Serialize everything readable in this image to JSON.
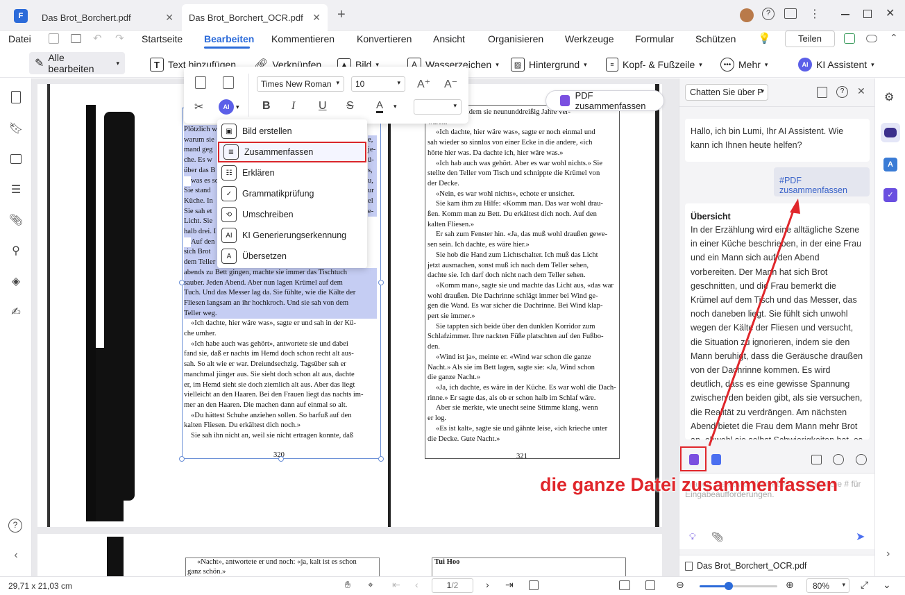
{
  "tabs": [
    {
      "label": "Das Brot_Borchert.pdf"
    },
    {
      "label": "Das Brot_Borchert_OCR.pdf"
    }
  ],
  "menu": {
    "file": "Datei",
    "items": [
      "Startseite",
      "Bearbeiten",
      "Kommentieren",
      "Konvertieren",
      "Ansicht",
      "Organisieren",
      "Werkzeuge",
      "Formular",
      "Schützen"
    ],
    "share": "Teilen"
  },
  "toolbar": {
    "edit_all": "Alle bearbeiten",
    "add_text": "Text hinzufügen",
    "link": "Verknüpfen",
    "image": "Bild",
    "watermark": "Wasserzeichen",
    "background": "Hintergrund",
    "header_footer": "Kopf- & Fußzeile",
    "more": "Mehr",
    "ai": "KI Assistent"
  },
  "format_popup": {
    "font": "Times New Roman",
    "size": "10"
  },
  "ai_menu": [
    "Bild erstellen",
    "Zusammenfassen",
    "Erklären",
    "Grammatikprüfung",
    "Umschreiben",
    "KI Generierungserkennung",
    "Übersetzen"
  ],
  "summarize_pdf_btn": "PDF zusammenfassen",
  "left_page": {
    "hl_lines": [
      "Plötzlich w",
      "warum sie",
      "mand geg",
      "che. Es w",
      "über das B",
      "was es so",
      "Sie stand",
      "Küche. In",
      "Sie sah et",
      "Licht. Sie",
      "halb drei. I",
      "Auf den",
      "sich Brot",
      "dem Teller",
      "abends zu Bett gingen, machte sie immer das Tischtuch",
      "sauber. Jeden Abend. Aber nun lagen Krümel auf dem",
      "Tuch. Und das Messer lag da. Sie fühlte, wie die Kälte der",
      "Fliesen langsam an ihr hochkroch. Und sie sah von dem",
      "Teller weg."
    ],
    "hl_right": [
      "e,",
      "je-",
      "ü-",
      "s,",
      "u,",
      "ur",
      "el",
      "e-",
      ""
    ],
    "lines": [
      "«Ich dachte, hier wäre was», sagte er und sah in der Kü-",
      "che umher.",
      "«Ich habe auch was gehört», antwortete sie und dabei",
      "fand sie, daß er nachts im Hemd doch schon recht alt aus-",
      "sah. So alt wie er war. Dreiundsechzig. Tagsüber sah er",
      "manchmal jünger aus. Sie sieht doch schon alt aus, dachte",
      "er, im Hemd sieht sie doch ziemlich alt aus. Aber das liegt",
      "vielleicht an den Haaren. Bei den Frauen liegt das nachts im-",
      "mer an den Haaren. Die machen dann auf einmal so alt.",
      "«Du hättest Schuhe anziehen sollen. So barfuß auf den",
      "kalten Fliesen. Du erkältest dich noch.»",
      "Sie sah ihn nicht an, weil sie nicht ertragen konnte, daß"
    ],
    "page_no": "320"
  },
  "right_page": {
    "lines": [
      "er log, nachdem sie neununddreißig Jahre ver-",
      "waren.",
      "«Ich dachte, hier wäre was», sagte er noch einmal und",
      "sah wieder so sinnlos von einer Ecke in die andere, «ich",
      "hörte hier was. Da dachte ich, hier wäre was.»",
      "«Ich hab auch was gehört. Aber es war wohl nichts.» Sie",
      "stellte den Teller vom Tisch und schnippte die Krümel von",
      "der Decke.",
      "«Nein, es war wohl nichts», echote er unsicher.",
      "Sie kam ihm zu Hilfe: «Komm man. Das war wohl drau-",
      "ßen. Komm man zu Bett. Du erkältest dich noch. Auf den",
      "kalten Fliesen.»",
      "Er sah zum Fenster hin. «Ja, das muß wohl draußen gewe-",
      "sen sein. Ich dachte, es wäre hier.»",
      "Sie hob die Hand zum Lichtschalter. Ich muß das Licht",
      "jetzt ausmachen, sonst muß ich nach dem Teller sehen,",
      "dachte sie. Ich darf doch nicht nach dem Teller sehen.",
      "«Komm man», sagte sie und machte das Licht aus, «das war",
      "wohl draußen. Die Dachrinne schlägt immer bei Wind ge-",
      "gen die Wand. Es war sicher die Dachrinne. Bei Wind klap-",
      "pert sie immer.»",
      "Sie tappten sich beide über den dunklen Korridor zum",
      "Schlafzimmer. Ihre nackten Füße platschten auf den Fußbo-",
      "den.",
      "«Wind ist ja», meinte er. «Wind war schon die ganze",
      "Nacht.» Als sie im Bett lagen, sagte sie: «Ja, Wind schon",
      "die ganze Nacht.»",
      "«Ja, ich dachte, es wäre in der Küche. Es war wohl die Dach-",
      "rinne.» Er sagte das, als ob er schon halb im Schlaf wäre.",
      "Aber sie merkte, wie unecht seine Stimme klang, wenn",
      "er log.",
      "«Es ist kalt», sagte sie und gähnte leise, «ich krieche unter",
      "die Decke. Gute Nacht.»"
    ],
    "page_no": "321"
  },
  "page2": {
    "left": "«Nacht», antwortete er und noch: «ja, kalt ist es schon",
    "left2": "ganz schön.»",
    "right": "Tui Hoo"
  },
  "chat": {
    "mode": "Chatten Sie über P",
    "greeting": "Hallo, ich bin Lumi, Ihr AI Assistent. Wie kann ich Ihnen heute helfen?",
    "user_msg": "#PDF zusammenfassen",
    "summary_title": "Übersicht",
    "summary": "In der Erzählung wird eine alltägliche Szene in einer Küche beschrieben, in der eine Frau und ein Mann sich auf den Abend vorbereiten. Der Mann hat sich Brot geschnitten, und die Frau bemerkt die Krümel auf dem Tisch und das Messer, das noch daneben liegt. Sie fühlt sich unwohl wegen der Kälte der Fliesen und versucht, die Situation zu ignorieren, indem sie den Mann beruhigt, dass die Geräusche draußen von der Dachrinne kommen. Es wird deutlich, dass es eine gewisse Spannung zwischen den beiden gibt, als sie versuchen, die Realität zu verdrängen. Am nächsten Abend bietet die Frau dem Mann mehr Brot an, obwohl sie selbst Schwierigkeiten hat, es zu",
    "input_placeholder": "Fragen Sie etwas über PDFs. Drücken Sie # für Eingabeaufforderungen.",
    "file": "Das Brot_Borchert_OCR.pdf"
  },
  "annotation": "die ganze Datei zusammenfassen",
  "status": {
    "dims": "29,71 x 21,03 cm",
    "page": "1",
    "total": "/2",
    "zoom": "80%"
  },
  "colors": {
    "accent": "#2c6bd9",
    "highlight": "#c5cdf3",
    "annotation": "#e0262b",
    "ai": "#5b5fe8"
  }
}
